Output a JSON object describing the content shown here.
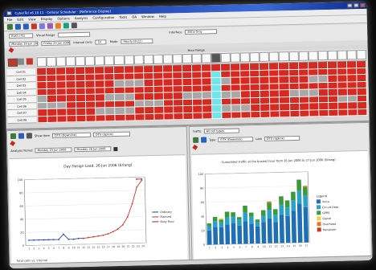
{
  "window": {
    "title": "CyberTel v6.10.11 · Cellular Scheduler · [Reference Display]",
    "menu": [
      "File",
      "Edit",
      "View",
      "Display",
      "Options",
      "Analysis",
      "Configuration",
      "Tools",
      "OA",
      "Window",
      "Help"
    ]
  },
  "controls": {
    "network": "BLK1 (T1)",
    "range_label": "Visual Range",
    "display_label": "Interface",
    "display_value": "BSCs-Only",
    "date_from": "Monday 19 Jun 2006",
    "date_to": "Friday 23 Jun 2006",
    "interval_label": "Interval (hrs)",
    "interval_value": "1h",
    "mode_label": "Mode",
    "mode_value": "Hourly (8-22)"
  },
  "schedule": {
    "header_label": "Hour Range",
    "row_labels": [
      "Cell 01",
      "Cell 02",
      "Cell 03",
      "Cell 04",
      "Cell 05",
      "Cell 06",
      "Cell 07",
      "Cell 08"
    ],
    "colors": {
      "red": "#d42a21",
      "gray": "#a8a8a8",
      "cyan": "#6fe6ee",
      "white": "#f4f4f4"
    },
    "rows": [
      "RRRRRRRRRRRRRRRRRRRRRRRRRRRRRRRRRR",
      "RRRRRRRRRRRRRRRRRRCRRRRRRRRRRRRRRR",
      "RRRRRRRRGGGRRRRRRRCGRRRRRRRRGGRRRR",
      "RRRRRRRRRRRRRRRRRRCRRRRRRRRRRRRRRR",
      "GRRRRRRGGGRRRRRGGGCGGRRRRRGGGRRRRR",
      "GGGRRRRRRRGGGRRRRRCRRRRRRRRRRRRGGR",
      "RRRRRRGGGGRRRRRRRRCGGGRRRRRRRRRRRR",
      "RRRRRRRRRRRRRRRRRRCRRRRRRRRRRRRRRR"
    ]
  },
  "left_panel": {
    "select_label": "Show Item",
    "select_value": "DTX (Downlink)",
    "select2_value": "DTX (Uplink)",
    "from_label": "Analysis Period",
    "from_value": "Monday 19 Jun 2006",
    "to_value": "Monday 26 Jun 2006",
    "footer_note": "Total calls vs. interval"
  },
  "right_panel": {
    "select_label": "Traffic",
    "select_value": "All cell types",
    "select2_label": "Type",
    "select2_value": "DTX (Downlink)",
    "select3_label": "Last",
    "select3_value": "DTX (Uplink)"
  },
  "chart_data": [
    {
      "type": "line",
      "title": "Day Design Load, 26 Jun 2006 (Erlang)",
      "x": [
        1,
        2,
        3,
        4,
        5,
        6,
        7,
        8,
        9,
        10,
        11,
        12,
        13,
        14,
        15,
        16,
        17,
        18,
        19,
        20,
        21,
        22,
        23,
        24
      ],
      "ylim": [
        0,
        100
      ],
      "series": [
        {
          "name": "Ordinary",
          "color": "#2a3fd0",
          "values": [
            8,
            8,
            8,
            8,
            8,
            8,
            8,
            16,
            8,
            8,
            9,
            9,
            null,
            null,
            null,
            null,
            null,
            null,
            null,
            null,
            null,
            null,
            null,
            null
          ]
        },
        {
          "name": "Planned",
          "color": "#d63030",
          "values": [
            null,
            null,
            null,
            null,
            null,
            null,
            null,
            null,
            null,
            null,
            null,
            9,
            10,
            11,
            12,
            13,
            15,
            18,
            22,
            28,
            40,
            60,
            85,
            95
          ]
        },
        {
          "name": "Busy Hour",
          "color": "#b22222",
          "values": [
            null,
            null,
            null,
            null,
            null,
            null,
            null,
            null,
            null,
            null,
            null,
            null,
            null,
            null,
            null,
            null,
            null,
            null,
            null,
            null,
            null,
            null,
            97,
            97
          ]
        }
      ]
    },
    {
      "type": "bar",
      "title": "Cumulated traffic at the busiest hour from 26 Jun 2006 to 27 Jun 2006 (Erlang)",
      "categories": [
        "1",
        "2",
        "3",
        "4",
        "5",
        "6",
        "7",
        "8",
        "9",
        "10",
        "11",
        "12",
        "13",
        "14",
        "15",
        "16",
        "17"
      ],
      "ylim": [
        0,
        100
      ],
      "legend_title": "Legend",
      "series": [
        {
          "name": "Voice",
          "color": "#1f6fb5",
          "values": [
            20,
            25,
            24,
            28,
            30,
            26,
            32,
            28,
            24,
            30,
            35,
            30,
            40,
            38,
            45,
            55,
            50
          ]
        },
        {
          "name": "Circuit Data",
          "color": "#2aa1c9",
          "values": [
            6,
            8,
            7,
            10,
            9,
            8,
            12,
            10,
            6,
            9,
            12,
            10,
            14,
            12,
            15,
            18,
            16
          ]
        },
        {
          "name": "GPRS",
          "color": "#3a9a3a",
          "values": [
            4,
            6,
            4,
            8,
            6,
            4,
            10,
            6,
            4,
            8,
            10,
            8,
            12,
            10,
            12,
            16,
            12
          ]
        },
        {
          "name": "Signal",
          "color": "#f2d23b",
          "values": [
            0,
            0,
            2,
            0,
            0,
            0,
            0,
            0,
            0,
            0,
            0,
            0,
            0,
            0,
            0,
            0,
            0
          ]
        },
        {
          "name": "Overhead",
          "color": "#e07a2a",
          "values": [
            0,
            0,
            0,
            0,
            0,
            0,
            0,
            0,
            0,
            0,
            2,
            0,
            0,
            0,
            0,
            0,
            2
          ]
        },
        {
          "name": "Handover",
          "color": "#c83a1e",
          "values": [
            0,
            0,
            0,
            0,
            0,
            0,
            0,
            0,
            0,
            0,
            0,
            0,
            0,
            0,
            0,
            0,
            0
          ]
        }
      ]
    }
  ]
}
